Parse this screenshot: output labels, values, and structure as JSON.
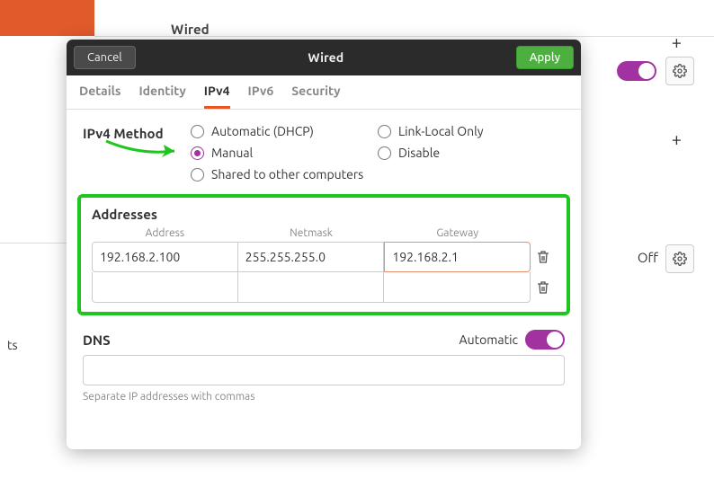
{
  "background": {
    "wired_label": "Wired",
    "off_label": "Off",
    "s_suffix": "ts"
  },
  "modal": {
    "cancel_label": "Cancel",
    "apply_label": "Apply",
    "title": "Wired",
    "tabs": {
      "details": "Details",
      "identity": "Identity",
      "ipv4": "IPv4",
      "ipv6": "IPv6",
      "security": "Security"
    },
    "ipv4_method": {
      "label": "IPv4 Method",
      "options": {
        "automatic": "Automatic (DHCP)",
        "link_local": "Link-Local Only",
        "manual": "Manual",
        "disable": "Disable",
        "shared": "Shared to other computers"
      },
      "selected": "manual"
    },
    "addresses": {
      "heading": "Addresses",
      "columns": {
        "address": "Address",
        "netmask": "Netmask",
        "gateway": "Gateway"
      },
      "rows": [
        {
          "address": "192.168.2.100",
          "netmask": "255.255.255.0",
          "gateway": "192.168.2.1"
        },
        {
          "address": "",
          "netmask": "",
          "gateway": ""
        }
      ]
    },
    "dns": {
      "heading": "DNS",
      "automatic_label": "Automatic",
      "automatic_on": true,
      "value": "",
      "help": "Separate IP addresses with commas"
    }
  },
  "colors": {
    "accent": "#e95420",
    "toggle": "#a132a0",
    "apply": "#4caf3f",
    "highlight": "#1fc61f"
  }
}
